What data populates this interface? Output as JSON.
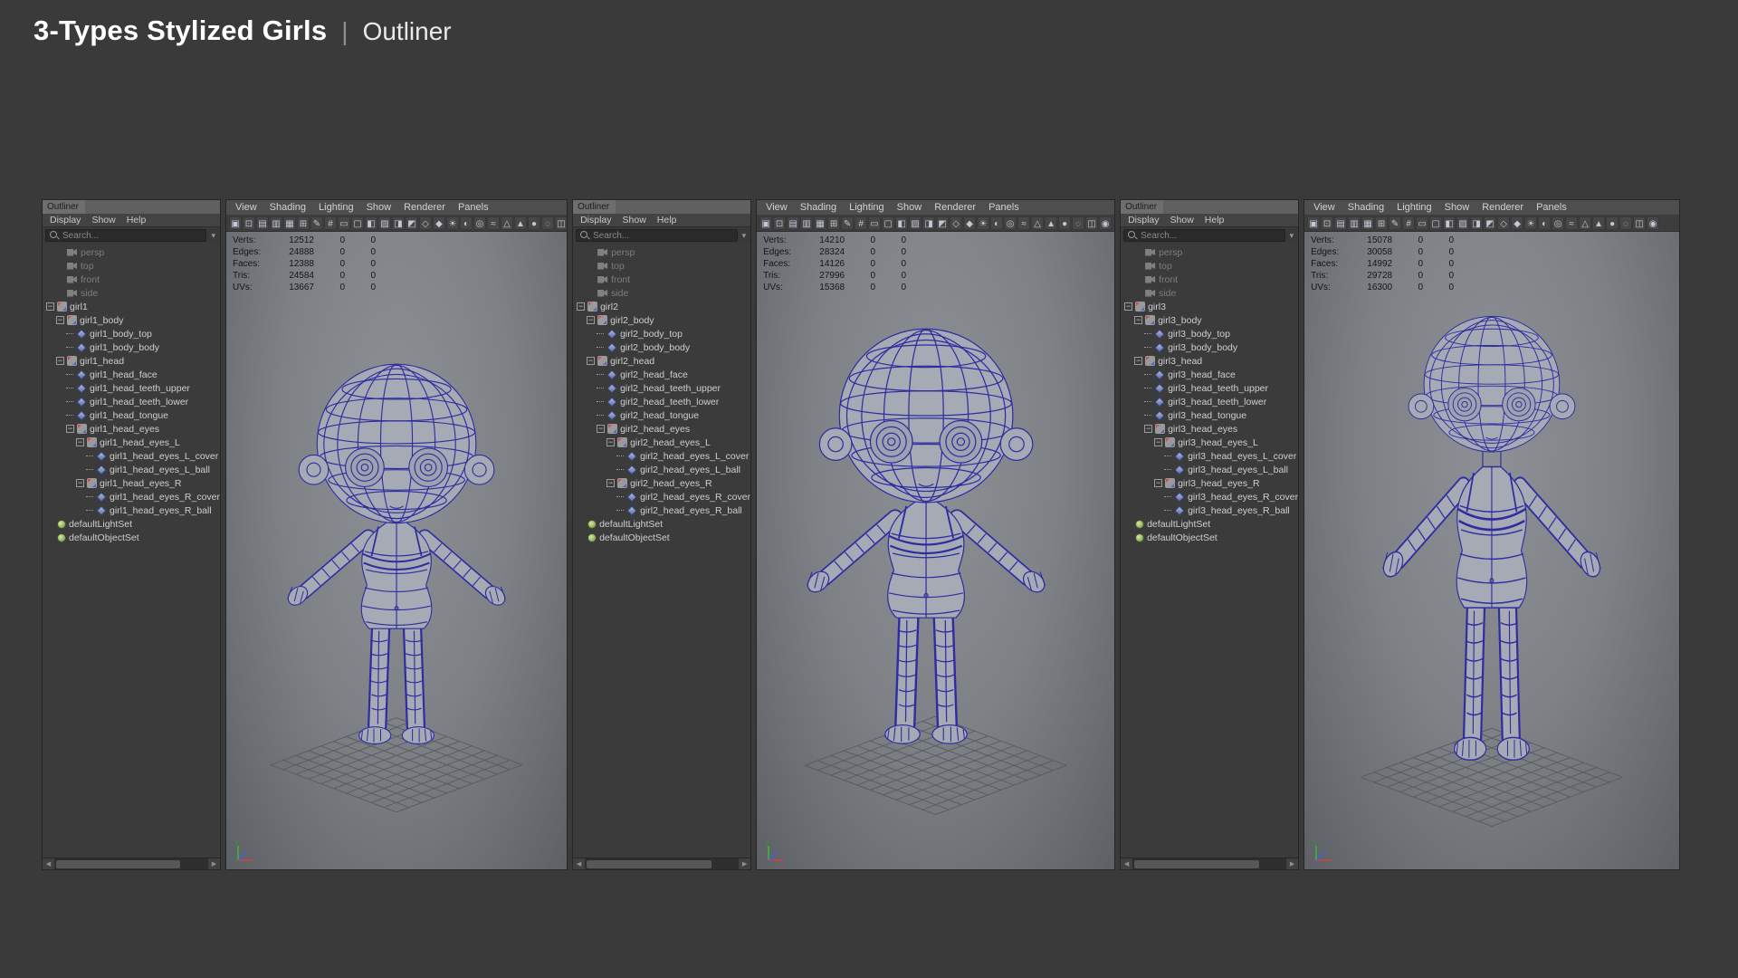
{
  "header": {
    "title": "3-Types Stylized Girls",
    "separator": "|",
    "subtitle": "Outliner"
  },
  "outliner": {
    "title": "Outliner",
    "menus": [
      "Display",
      "Show",
      "Help"
    ],
    "search_placeholder": "Search...",
    "cameras": [
      "persp",
      "top",
      "front",
      "side"
    ]
  },
  "viewport": {
    "menus": [
      "View",
      "Shading",
      "Lighting",
      "Show",
      "Renderer",
      "Panels"
    ],
    "toolbar_icons": [
      {
        "name": "select-camera",
        "glyph": "▣"
      },
      {
        "name": "lock-camera",
        "glyph": "⊡"
      },
      {
        "name": "camera-attributes",
        "glyph": "▤"
      },
      {
        "name": "bookmarks",
        "glyph": "▥"
      },
      {
        "name": "image-plane",
        "glyph": "▦"
      },
      {
        "name": "2d-pan-zoom",
        "glyph": "⊞"
      },
      {
        "name": "grease-pencil",
        "glyph": "✎"
      },
      {
        "name": "grid",
        "glyph": "#"
      },
      {
        "name": "film-gate",
        "glyph": "▭"
      },
      {
        "name": "resolution-gate",
        "glyph": "▢"
      },
      {
        "name": "gate-mask",
        "glyph": "◧"
      },
      {
        "name": "field-chart",
        "glyph": "▨"
      },
      {
        "name": "safe-action",
        "glyph": "◨"
      },
      {
        "name": "safe-title",
        "glyph": "◩"
      },
      {
        "name": "frame-all",
        "glyph": "◇"
      },
      {
        "name": "frame-selection",
        "glyph": "◆"
      },
      {
        "name": "lighting",
        "glyph": "☀"
      },
      {
        "name": "shadows",
        "glyph": "◐"
      },
      {
        "name": "ambient-occlusion",
        "glyph": "◎"
      },
      {
        "name": "anti-aliasing",
        "glyph": "≈"
      },
      {
        "name": "wireframe",
        "glyph": "△"
      },
      {
        "name": "shaded",
        "glyph": "▲"
      },
      {
        "name": "textured",
        "glyph": "●"
      },
      {
        "name": "use-default-material",
        "glyph": "◌"
      },
      {
        "name": "xray",
        "glyph": "◫"
      },
      {
        "name": "isolate-select",
        "glyph": "◉"
      }
    ]
  },
  "panels": [
    {
      "id": "girl1",
      "stats": {
        "rows": [
          {
            "label": "Verts:",
            "value": "12512",
            "sel": "0",
            "sel2": "0"
          },
          {
            "label": "Edges:",
            "value": "24888",
            "sel": "0",
            "sel2": "0"
          },
          {
            "label": "Faces:",
            "value": "12388",
            "sel": "0",
            "sel2": "0"
          },
          {
            "label": "Tris:",
            "value": "24584",
            "sel": "0",
            "sel2": "0"
          },
          {
            "label": "UVs:",
            "value": "13667",
            "sel": "0",
            "sel2": "0"
          }
        ]
      },
      "tree": [
        {
          "label": "girl1",
          "depth": 0,
          "type": "transform",
          "children": true
        },
        {
          "label": "girl1_body",
          "depth": 1,
          "type": "transform",
          "children": true
        },
        {
          "label": "girl1_body_top",
          "depth": 2,
          "type": "mesh",
          "children": false
        },
        {
          "label": "girl1_body_body",
          "depth": 2,
          "type": "mesh",
          "children": false
        },
        {
          "label": "girl1_head",
          "depth": 1,
          "type": "transform",
          "children": true
        },
        {
          "label": "girl1_head_face",
          "depth": 2,
          "type": "mesh",
          "children": false
        },
        {
          "label": "girl1_head_teeth_upper",
          "depth": 2,
          "type": "mesh",
          "children": false
        },
        {
          "label": "girl1_head_teeth_lower",
          "depth": 2,
          "type": "mesh",
          "children": false
        },
        {
          "label": "girl1_head_tongue",
          "depth": 2,
          "type": "mesh",
          "children": false
        },
        {
          "label": "girl1_head_eyes",
          "depth": 2,
          "type": "transform",
          "children": true
        },
        {
          "label": "girl1_head_eyes_L",
          "depth": 3,
          "type": "transform",
          "children": true
        },
        {
          "label": "girl1_head_eyes_L_cover",
          "depth": 4,
          "type": "mesh",
          "children": false
        },
        {
          "label": "girl1_head_eyes_L_ball",
          "depth": 4,
          "type": "mesh",
          "children": false
        },
        {
          "label": "girl1_head_eyes_R",
          "depth": 3,
          "type": "transform",
          "children": true
        },
        {
          "label": "girl1_head_eyes_R_cover",
          "depth": 4,
          "type": "mesh",
          "children": false
        },
        {
          "label": "girl1_head_eyes_R_ball",
          "depth": 4,
          "type": "mesh",
          "children": false
        }
      ],
      "sets": [
        "defaultLightSet",
        "defaultObjectSet"
      ]
    },
    {
      "id": "girl2",
      "stats": {
        "rows": [
          {
            "label": "Verts:",
            "value": "14210",
            "sel": "0",
            "sel2": "0"
          },
          {
            "label": "Edges:",
            "value": "28324",
            "sel": "0",
            "sel2": "0"
          },
          {
            "label": "Faces:",
            "value": "14126",
            "sel": "0",
            "sel2": "0"
          },
          {
            "label": "Tris:",
            "value": "27996",
            "sel": "0",
            "sel2": "0"
          },
          {
            "label": "UVs:",
            "value": "15368",
            "sel": "0",
            "sel2": "0"
          }
        ]
      },
      "tree": [
        {
          "label": "girl2",
          "depth": 0,
          "type": "transform",
          "children": true
        },
        {
          "label": "girl2_body",
          "depth": 1,
          "type": "transform",
          "children": true
        },
        {
          "label": "girl2_body_top",
          "depth": 2,
          "type": "mesh",
          "children": false
        },
        {
          "label": "girl2_body_body",
          "depth": 2,
          "type": "mesh",
          "children": false
        },
        {
          "label": "girl2_head",
          "depth": 1,
          "type": "transform",
          "children": true
        },
        {
          "label": "girl2_head_face",
          "depth": 2,
          "type": "mesh",
          "children": false
        },
        {
          "label": "girl2_head_teeth_upper",
          "depth": 2,
          "type": "mesh",
          "children": false
        },
        {
          "label": "girl2_head_teeth_lower",
          "depth": 2,
          "type": "mesh",
          "children": false
        },
        {
          "label": "girl2_head_tongue",
          "depth": 2,
          "type": "mesh",
          "children": false
        },
        {
          "label": "girl2_head_eyes",
          "depth": 2,
          "type": "transform",
          "children": true
        },
        {
          "label": "girl2_head_eyes_L",
          "depth": 3,
          "type": "transform",
          "children": true
        },
        {
          "label": "girl2_head_eyes_L_cover",
          "depth": 4,
          "type": "mesh",
          "children": false
        },
        {
          "label": "girl2_head_eyes_L_ball",
          "depth": 4,
          "type": "mesh",
          "children": false
        },
        {
          "label": "girl2_head_eyes_R",
          "depth": 3,
          "type": "transform",
          "children": true
        },
        {
          "label": "girl2_head_eyes_R_cover",
          "depth": 4,
          "type": "mesh",
          "children": false
        },
        {
          "label": "girl2_head_eyes_R_ball",
          "depth": 4,
          "type": "mesh",
          "children": false
        }
      ],
      "sets": [
        "defaultLightSet",
        "defaultObjectSet"
      ]
    },
    {
      "id": "girl3",
      "stats": {
        "rows": [
          {
            "label": "Verts:",
            "value": "15078",
            "sel": "0",
            "sel2": "0"
          },
          {
            "label": "Edges:",
            "value": "30058",
            "sel": "0",
            "sel2": "0"
          },
          {
            "label": "Faces:",
            "value": "14992",
            "sel": "0",
            "sel2": "0"
          },
          {
            "label": "Tris:",
            "value": "29728",
            "sel": "0",
            "sel2": "0"
          },
          {
            "label": "UVs:",
            "value": "16300",
            "sel": "0",
            "sel2": "0"
          }
        ]
      },
      "tree": [
        {
          "label": "girl3",
          "depth": 0,
          "type": "transform",
          "children": true
        },
        {
          "label": "girl3_body",
          "depth": 1,
          "type": "transform",
          "children": true
        },
        {
          "label": "girl3_body_top",
          "depth": 2,
          "type": "mesh",
          "children": false
        },
        {
          "label": "girl3_body_body",
          "depth": 2,
          "type": "mesh",
          "children": false
        },
        {
          "label": "girl3_head",
          "depth": 1,
          "type": "transform",
          "children": true
        },
        {
          "label": "girl3_head_face",
          "depth": 2,
          "type": "mesh",
          "children": false
        },
        {
          "label": "girl3_head_teeth_upper",
          "depth": 2,
          "type": "mesh",
          "children": false
        },
        {
          "label": "girl3_head_teeth_lower",
          "depth": 2,
          "type": "mesh",
          "children": false
        },
        {
          "label": "girl3_head_tongue",
          "depth": 2,
          "type": "mesh",
          "children": false
        },
        {
          "label": "girl3_head_eyes",
          "depth": 2,
          "type": "transform",
          "children": true
        },
        {
          "label": "girl3_head_eyes_L",
          "depth": 3,
          "type": "transform",
          "children": true
        },
        {
          "label": "girl3_head_eyes_L_cover",
          "depth": 4,
          "type": "mesh",
          "children": false
        },
        {
          "label": "girl3_head_eyes_L_ball",
          "depth": 4,
          "type": "mesh",
          "children": false
        },
        {
          "label": "girl3_head_eyes_R",
          "depth": 3,
          "type": "transform",
          "children": true
        },
        {
          "label": "girl3_head_eyes_R_cover",
          "depth": 4,
          "type": "mesh",
          "children": false
        },
        {
          "label": "girl3_head_eyes_R_ball",
          "depth": 4,
          "type": "mesh",
          "children": false
        }
      ],
      "sets": [
        "defaultLightSet",
        "defaultObjectSet"
      ]
    }
  ]
}
